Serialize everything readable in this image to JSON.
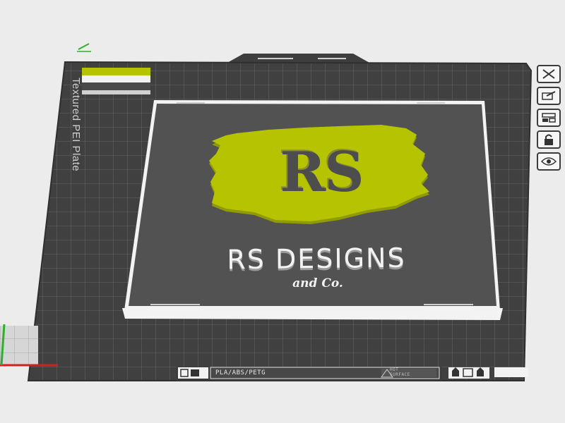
{
  "bed": {
    "plate_label": "Textured PEI Plate",
    "filament_label": "PLA/ABS/PETG",
    "hot_surface_label": [
      "HOT",
      "SURFACE"
    ]
  },
  "model": {
    "logo_letters": "RS",
    "title": "RS DESIGNS",
    "subtitle": "and Co."
  },
  "toolbar": {
    "icons": [
      "close-icon",
      "auto-orient-icon",
      "arrange-icon",
      "lock-icon",
      "eye-icon"
    ]
  },
  "colors": {
    "background": "#ececec",
    "bed": "#424242",
    "grid": "#666666",
    "plate": "#525252",
    "accent": "#b5c300",
    "text_light": "#f2f2f2"
  }
}
